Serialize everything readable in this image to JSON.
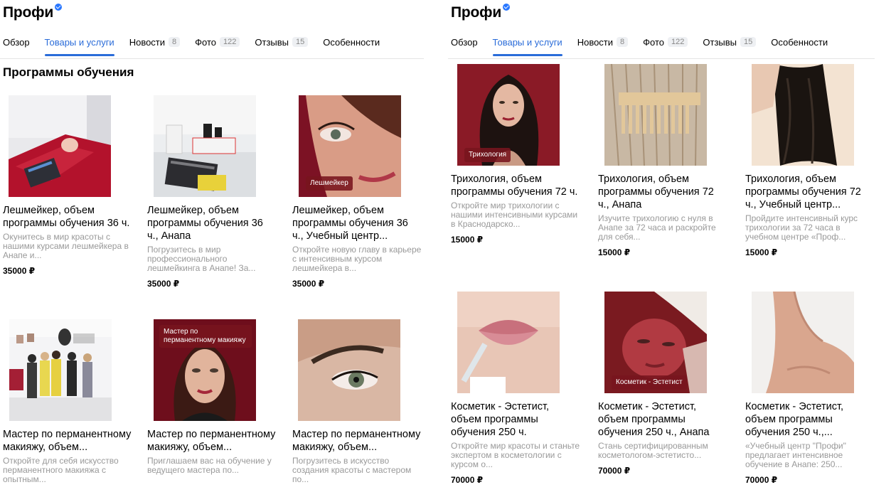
{
  "left": {
    "title": "Профи",
    "tabs": [
      {
        "label": "Обзор",
        "count": ""
      },
      {
        "label": "Товары и услуги",
        "count": ""
      },
      {
        "label": "Новости",
        "count": "8"
      },
      {
        "label": "Фото",
        "count": "122"
      },
      {
        "label": "Отзывы",
        "count": "15"
      },
      {
        "label": "Особенности",
        "count": ""
      }
    ],
    "section_title": "Программы обучения",
    "cards": [
      {
        "title": "Лешмейкер, объем программы обучения 36 ч.",
        "desc": "Окунитесь в мир красоты с нашими курсами лешмейкера в Анапе и...",
        "price": "35000 ₽",
        "tag": ""
      },
      {
        "title": "Лешмейкер, объем программы обучения 36 ч., Анапа",
        "desc": "Погрузитесь в мир профессионального лешмейкинга в Анапе! За...",
        "price": "35000 ₽",
        "tag": ""
      },
      {
        "title": "Лешмейкер, объем программы обучения 36 ч., Учебный центр...",
        "desc": "Откройте новую главу в карьере с интенсивным курсом лешмейкера в...",
        "price": "35000 ₽",
        "tag": "Лешмейкер"
      },
      {
        "title": "Мастер по перманентному макияжу, объем...",
        "desc": "Откройте для себя искусство перманентного макияжа с опытным...",
        "price": "",
        "tag": ""
      },
      {
        "title": "Мастер по перманентному макияжу, объем...",
        "desc": "Приглашаем вас на обучение у ведущего мастера по...",
        "price": "",
        "tag": "Мастер по перманентному макияжу"
      },
      {
        "title": "Мастер по перманентному макияжу, объем...",
        "desc": "Погрузитесь в искусство создания красоты с мастером по...",
        "price": "",
        "tag": ""
      }
    ]
  },
  "right": {
    "title": "Профи",
    "tabs": [
      {
        "label": "Обзор",
        "count": ""
      },
      {
        "label": "Товары и услуги",
        "count": ""
      },
      {
        "label": "Новости",
        "count": "8"
      },
      {
        "label": "Фото",
        "count": "122"
      },
      {
        "label": "Отзывы",
        "count": "15"
      },
      {
        "label": "Особенности",
        "count": ""
      }
    ],
    "cards": [
      {
        "title": "Трихология, объем программы обучения 72 ч.",
        "desc": "Откройте мир трихологии с нашими интенсивными курсами в Краснодарско...",
        "price": "15000 ₽",
        "tag": "Трихология"
      },
      {
        "title": "Трихология, объем программы обучения 72 ч., Анапа",
        "desc": "Изучите трихологию с нуля в Анапе за 72 часа и раскройте для себя...",
        "price": "15000 ₽",
        "tag": ""
      },
      {
        "title": "Трихология, объем программы обучения 72 ч., Учебный центр...",
        "desc": "Пройдите интенсивный курс трихологии за 72 часа в учебном центре «Проф...",
        "price": "15000 ₽",
        "tag": ""
      },
      {
        "title": "Косметик - Эстетист, объем программы обучения 250 ч.",
        "desc": "Откройте мир красоты и станьте экспертом в косметологии с курсом о...",
        "price": "70000 ₽",
        "tag": ""
      },
      {
        "title": "Косметик - Эстетист, объем программы обучения 250 ч., Анапа",
        "desc": "Стань сертифицированным косметологом-эстетисто...",
        "price": "70000 ₽",
        "tag": "Косметик - Эстетист"
      },
      {
        "title": "Косметик - Эстетист, объем программы обучения 250 ч.,...",
        "desc": "«Учебный центр \"Профи\" предлагает интенсивное обучение в Анапе: 250...",
        "price": "70000 ₽",
        "tag": ""
      }
    ]
  }
}
